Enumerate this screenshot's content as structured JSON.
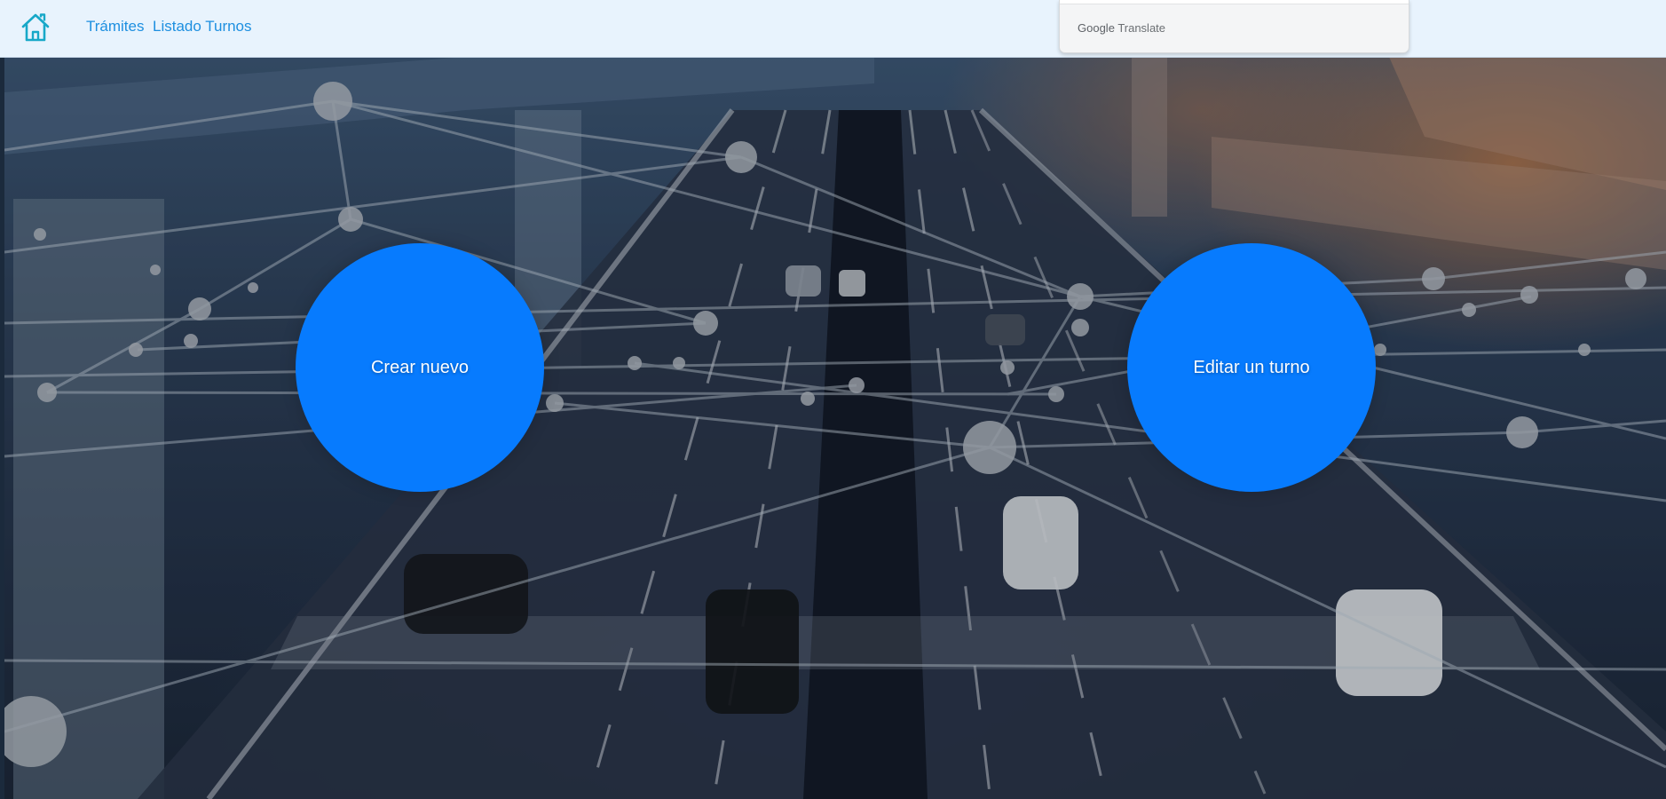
{
  "navbar": {
    "home_icon": "home-icon",
    "links": [
      {
        "label": "Trámites"
      },
      {
        "label": "Listado Turnos"
      }
    ]
  },
  "translate": {
    "brand_google": "Google",
    "brand_translate": "Translate"
  },
  "main": {
    "actions": [
      {
        "label": "Crear nuevo"
      },
      {
        "label": "Editar un turno"
      }
    ]
  },
  "colors": {
    "accent": "#077bfe",
    "nav_link": "#1d8fe0",
    "nav_background": "#e8f3fd",
    "home_icon": "#17a8c8"
  }
}
